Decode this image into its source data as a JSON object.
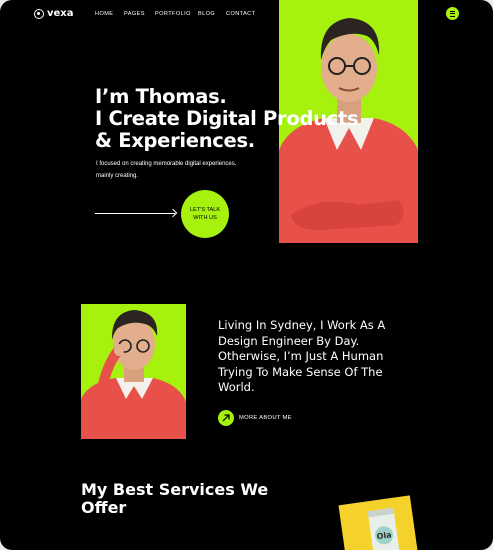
{
  "brand": {
    "name": "vexa"
  },
  "nav": {
    "items": [
      "HOME",
      "PAGES",
      "PORTFOLIO",
      "BLOG",
      "CONTACT"
    ]
  },
  "hero": {
    "title_lines": [
      "I’m Thomas.",
      "I Create Digital Products",
      "& Experiences."
    ],
    "description": "I focused on creating memorable digital experiences, mainly creating.",
    "cta_label": "LET’S TALK WITH US"
  },
  "about": {
    "text": "Living In Sydney, I Work As A Design Engineer By Day. Otherwise, I’m Just A Human Trying To Make Sense Of The World.",
    "more_label": "MORE ABOUT ME"
  },
  "services": {
    "title": "My Best Services We Offer"
  },
  "product": {
    "can_text": "Ola"
  },
  "colors": {
    "accent": "#a6f10e",
    "background": "#000000",
    "sweater": "#e8504a",
    "product_bg": "#f5d22b"
  }
}
